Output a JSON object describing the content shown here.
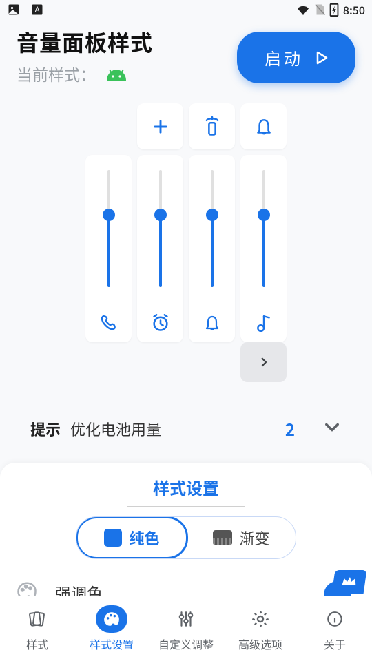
{
  "status": {
    "time": "8:50"
  },
  "header": {
    "title": "音量面板样式",
    "subtitle": "当前样式：",
    "launch_label": "启动"
  },
  "preview": {
    "accent": "#1a73e8",
    "icon_buttons": [
      "plus",
      "speaker-cast",
      "bell"
    ],
    "sliders": [
      {
        "icon": "phone",
        "value": 0.62
      },
      {
        "icon": "alarm",
        "value": 0.62
      },
      {
        "icon": "bell",
        "value": 0.62
      },
      {
        "icon": "music-note",
        "value": 0.62
      }
    ]
  },
  "tips": {
    "label": "提示",
    "text": "优化电池用量",
    "count": "2"
  },
  "sheet": {
    "title": "样式设置",
    "seg_solid": "纯色",
    "seg_gradient": "渐变",
    "accent_label": "强调色",
    "accent_value": "#1a73e8"
  },
  "nav": {
    "items": [
      {
        "label": "样式"
      },
      {
        "label": "样式设置"
      },
      {
        "label": "自定义调整"
      },
      {
        "label": "高级选项"
      },
      {
        "label": "关于"
      }
    ],
    "active_index": 1
  }
}
